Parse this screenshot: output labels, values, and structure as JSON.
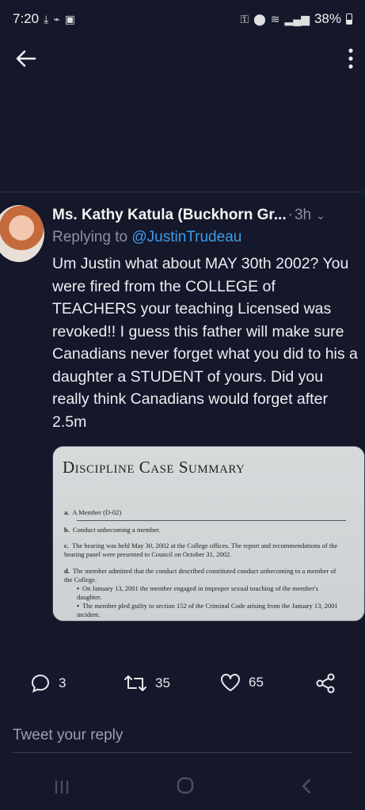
{
  "status": {
    "time": "7:20",
    "battery": "38%",
    "icons_left": [
      "download-icon",
      "vpn-icon",
      "app-icon"
    ],
    "icons_right": [
      "key-icon",
      "location-icon",
      "wifi-icon",
      "signal-icon",
      "battery-icon"
    ]
  },
  "header": {
    "back_icon": "back-arrow-icon",
    "menu_icon": "more-vertical-icon"
  },
  "tweet": {
    "author": "Ms. Kathy Katula (Buckhorn Gr...",
    "separator": "·",
    "time": "3h",
    "replying_prefix": "Replying to ",
    "replying_to": "@JustinTrudeau",
    "text": "Um Justin what about MAY 30th 2002? You were fired from the COLLEGE of TEACHERS your teaching Licensed was revoked!! I guess this father will make sure Canadians never forget what you did to his a daughter a STUDENT of yours. Did you really think Canadians would forget after 2.5m",
    "media": {
      "title": "Discipline Case Summary",
      "items": [
        {
          "label": "a.",
          "text": "A Member (D-02)"
        },
        {
          "label": "b.",
          "text": "Conduct unbecoming a member."
        },
        {
          "label": "c.",
          "text": "The hearing was held May 30, 2002 at the College offices. The report and recommendations of the hearing panel were presented to Council on October 31, 2002."
        },
        {
          "label": "d.",
          "text": "The member admitted that the conduct described constituted conduct unbecoming to a member of the College."
        },
        {
          "label": "•",
          "text": "On January 13, 2001 the member engaged in improper sexual touching of the member's daughter."
        },
        {
          "label": "•",
          "text": "The member pled guilty to section 152 of the Criminal Code arising from the January 13, 2001 incident."
        }
      ]
    }
  },
  "actions": {
    "replies": "3",
    "retweets": "35",
    "likes": "65"
  },
  "reply_box": {
    "placeholder": "Tweet your reply"
  },
  "nav": {
    "recent_icon": "recent-apps-icon",
    "home_icon": "home-icon",
    "back_icon": "back-icon"
  }
}
